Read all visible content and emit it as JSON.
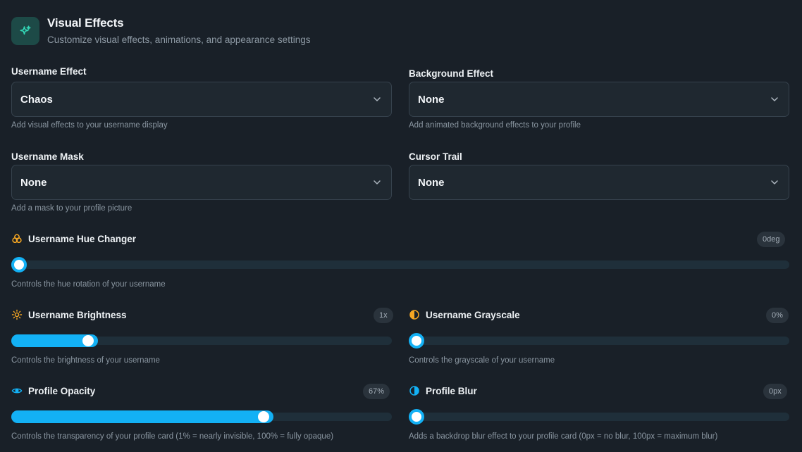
{
  "header": {
    "title": "Visual Effects",
    "subtitle": "Customize visual effects, animations, and appearance settings",
    "icon": "sparkles-icon"
  },
  "selects": {
    "username_effect": {
      "label": "Username Effect",
      "value": "Chaos",
      "hint": "Add visual effects to your username display"
    },
    "background_effect": {
      "label": "Background Effect",
      "value": "None",
      "hint": "Add animated background effects to your profile"
    },
    "username_mask": {
      "label": "Username Mask",
      "value": "None",
      "hint": "Add a mask to your profile picture"
    },
    "cursor_trail": {
      "label": "Cursor Trail",
      "value": "None",
      "hint": ""
    }
  },
  "sliders": {
    "hue": {
      "label": "Username Hue Changer",
      "badge": "0deg",
      "hint": "Controls the hue rotation of your username",
      "value": 0,
      "icon": "palette-icon"
    },
    "brightness": {
      "label": "Username Brightness",
      "badge": "1x",
      "hint": "Controls the brightness of your username",
      "value": 0.19,
      "icon": "sun-icon"
    },
    "grayscale": {
      "label": "Username Grayscale",
      "badge": "0%",
      "hint": "Controls the grayscale of your username",
      "value": 0,
      "icon": "half-circle-icon"
    },
    "opacity": {
      "label": "Profile Opacity",
      "badge": "67%",
      "hint": "Controls the transparency of your profile card (1% = nearly invisible, 100% = fully opaque)",
      "value": 0.67,
      "icon": "eye-icon"
    },
    "blur": {
      "label": "Profile Blur",
      "badge": "0px",
      "hint": "Adds a backdrop blur effect to your profile card (0px = no blur, 100px = maximum blur)",
      "value": 0,
      "icon": "blur-circle-icon"
    }
  },
  "colors": {
    "background": "#192028",
    "accent": "#13b1f5",
    "header_icon_bg": "#1d4a47",
    "header_icon": "#33d6b6",
    "hue_icon": "#f5a623",
    "brightness_icon": "#f5a623",
    "grayscale_icon": "#f5a623",
    "opacity_icon": "#13b1f5",
    "blur_icon": "#13b1f5"
  }
}
